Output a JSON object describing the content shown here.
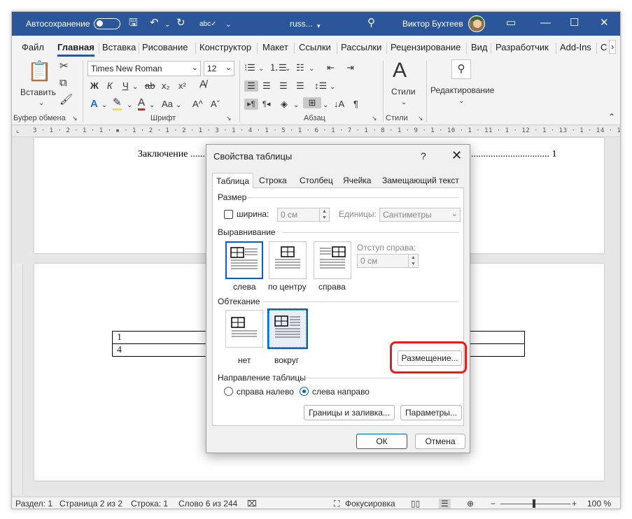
{
  "titlebar": {
    "autosave_label": "Автосохранение",
    "doc_name": "russ...",
    "user_name": "Виктор Бухтеев",
    "icons": [
      "save-icon",
      "undo-icon",
      "redo-icon",
      "spelling-icon",
      "search-icon",
      "minimize-icon",
      "maximize-icon",
      "close-icon"
    ]
  },
  "ribbon_tabs": [
    "Файл",
    "Главная",
    "Вставка",
    "Рисование",
    "Конструктор",
    "Макет",
    "Ссылки",
    "Рассылки",
    "Рецензирование",
    "Вид",
    "Разработчик",
    "Add-Ins",
    "С"
  ],
  "ribbon": {
    "paste_label": "Вставить",
    "clipboard_label": "Буфер обмена",
    "font_name": "Times New Roman",
    "font_size": "12",
    "font_group_label": "Шрифт",
    "paragraph_group_label": "Абзац",
    "styles_label": "Стили",
    "styles_group_label": "Стили",
    "editing_label": "Редактирование",
    "bold": "Ж",
    "italic": "К",
    "underline": "Ч",
    "strike": "ab",
    "subscript": "x₂",
    "superscript": "x²",
    "case": "Aa",
    "grow": "A^",
    "shrink": "Aˇ",
    "pilcrow": "¶"
  },
  "ruler": {
    "scale": "3 · 1 · 2 · 1 · 1 · ▪ · 1 · 2 · 1 · 2 · 1 · 3 · 1 · 4 · 1 · 5 · 1 · 6 · 1 · 7 · 1 · 8 · 1 · 9 · 1 · 10 · 1 · 11 · 1 · 12 · 1 · 13 · 1 · 14 · 1 · 15 · 1 · 16 · 1 · 17 · 1 · 18 ·"
  },
  "document": {
    "toc_text": "Заключение ......",
    "toc_dots": "................................ 1",
    "table_rows": [
      [
        "1",
        ""
      ],
      [
        "4",
        ""
      ]
    ]
  },
  "dialog": {
    "title": "Свойства таблицы",
    "help": "?",
    "tabs": [
      "Таблица",
      "Строка",
      "Столбец",
      "Ячейка",
      "Замещающий текст"
    ],
    "size_section": "Размер",
    "width_label": "ширина:",
    "width_value": "0 см",
    "units_label": "Единицы:",
    "units_value": "Сантиметры",
    "alignment_section": "Выравнивание",
    "align_options": [
      "слева",
      "по центру",
      "справа"
    ],
    "indent_label": "Отступ справа:",
    "indent_value": "0 см",
    "wrap_section": "Обтекание",
    "wrap_options": [
      "нет",
      "вокруг"
    ],
    "positioning_button": "Размещение...",
    "direction_section": "Направление таблицы",
    "direction_options": [
      "справа налево",
      "слева направо"
    ],
    "borders_button": "Границы и заливка...",
    "options_button": "Параметры...",
    "ok": "ОК",
    "cancel": "Отмена"
  },
  "statusbar": {
    "section": "Раздел: 1",
    "page": "Страница 2 из 2",
    "line": "Строка: 1",
    "word": "Слово 6 из 244",
    "focus": "Фокусировка",
    "zoom": "100 %"
  },
  "colors": {
    "titlebar": "#2b579a",
    "accent": "#0067c0",
    "highlight": "#e41e1e"
  }
}
